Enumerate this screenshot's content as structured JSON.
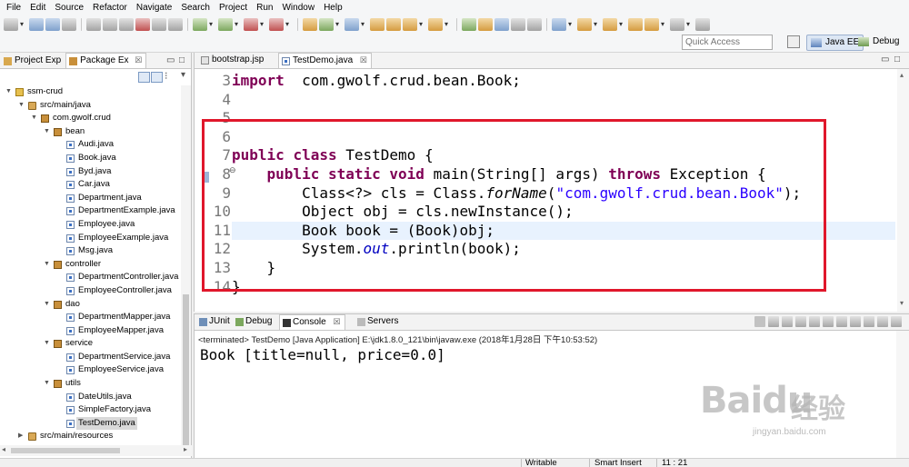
{
  "menu": [
    "File",
    "Edit",
    "Source",
    "Refactor",
    "Navigate",
    "Search",
    "Project",
    "Run",
    "Window",
    "Help"
  ],
  "quick_access": {
    "placeholder": "Quick Access"
  },
  "perspectives": {
    "java_ee": "Java EE",
    "debug": "Debug"
  },
  "left_panel": {
    "tabs": [
      {
        "label": "Project Exp"
      },
      {
        "label": "Package Ex"
      }
    ],
    "tree": [
      {
        "label": "ssm-crud",
        "depth": 0,
        "icon": "project-icon",
        "expanded": true
      },
      {
        "label": "src/main/java",
        "depth": 1,
        "icon": "source-folder-icon",
        "expanded": true
      },
      {
        "label": "com.gwolf.crud",
        "depth": 2,
        "icon": "package-icon",
        "expanded": true
      },
      {
        "label": "bean",
        "depth": 3,
        "icon": "package-icon",
        "expanded": true
      },
      {
        "label": "Audi.java",
        "depth": 4,
        "icon": "java-file-icon"
      },
      {
        "label": "Book.java",
        "depth": 4,
        "icon": "java-file-icon"
      },
      {
        "label": "Byd.java",
        "depth": 4,
        "icon": "java-file-icon"
      },
      {
        "label": "Car.java",
        "depth": 4,
        "icon": "java-file-icon"
      },
      {
        "label": "Department.java",
        "depth": 4,
        "icon": "java-file-icon"
      },
      {
        "label": "DepartmentExample.java",
        "depth": 4,
        "icon": "java-file-icon"
      },
      {
        "label": "Employee.java",
        "depth": 4,
        "icon": "java-file-icon"
      },
      {
        "label": "EmployeeExample.java",
        "depth": 4,
        "icon": "java-file-icon"
      },
      {
        "label": "Msg.java",
        "depth": 4,
        "icon": "java-file-icon"
      },
      {
        "label": "controller",
        "depth": 3,
        "icon": "package-icon",
        "expanded": true
      },
      {
        "label": "DepartmentController.java",
        "depth": 4,
        "icon": "java-file-icon"
      },
      {
        "label": "EmployeeController.java",
        "depth": 4,
        "icon": "java-file-icon"
      },
      {
        "label": "dao",
        "depth": 3,
        "icon": "package-icon",
        "expanded": true
      },
      {
        "label": "DepartmentMapper.java",
        "depth": 4,
        "icon": "java-file-icon"
      },
      {
        "label": "EmployeeMapper.java",
        "depth": 4,
        "icon": "java-file-icon"
      },
      {
        "label": "service",
        "depth": 3,
        "icon": "package-icon",
        "expanded": true
      },
      {
        "label": "DepartmentService.java",
        "depth": 4,
        "icon": "java-file-icon"
      },
      {
        "label": "EmployeeService.java",
        "depth": 4,
        "icon": "java-file-icon"
      },
      {
        "label": "utils",
        "depth": 3,
        "icon": "package-icon",
        "expanded": true
      },
      {
        "label": "DateUtils.java",
        "depth": 4,
        "icon": "java-file-icon"
      },
      {
        "label": "SimpleFactory.java",
        "depth": 4,
        "icon": "java-file-icon"
      },
      {
        "label": "TestDemo.java",
        "depth": 4,
        "icon": "java-file-icon",
        "selected": true
      },
      {
        "label": "src/main/resources",
        "depth": 1,
        "icon": "source-folder-icon",
        "expanded": false
      }
    ]
  },
  "editor": {
    "tabs": [
      {
        "label": "bootstrap.jsp"
      },
      {
        "label": "TestDemo.java",
        "active": true
      }
    ],
    "current_line": 11,
    "lines": [
      {
        "n": "3",
        "parts": [
          [
            "kw",
            "import"
          ],
          [
            "",
            "  com.gwolf.crud.bean.Book;"
          ]
        ]
      },
      {
        "n": "4",
        "parts": []
      },
      {
        "n": "5",
        "parts": []
      },
      {
        "n": "6",
        "parts": []
      },
      {
        "n": "7",
        "parts": [
          [
            "kw",
            "public"
          ],
          [
            "",
            " "
          ],
          [
            "kw",
            "class"
          ],
          [
            "",
            " TestDemo {"
          ]
        ]
      },
      {
        "n": "8",
        "parts": [
          [
            "",
            "    "
          ],
          [
            "kw",
            "public"
          ],
          [
            "",
            " "
          ],
          [
            "kw",
            "static"
          ],
          [
            "",
            " "
          ],
          [
            "kw",
            "void"
          ],
          [
            "",
            " main(String[] args) "
          ],
          [
            "kw",
            "throws"
          ],
          [
            "",
            " Exception {"
          ]
        ]
      },
      {
        "n": "9",
        "parts": [
          [
            "",
            "        Class<?> cls = Class."
          ],
          [
            "it",
            "forName"
          ],
          [
            "",
            "("
          ],
          [
            "str",
            "\"com.gwolf.crud.bean.Book\""
          ],
          [
            "",
            ");"
          ]
        ]
      },
      {
        "n": "10",
        "parts": [
          [
            "",
            "        Object obj = cls.newInstance();"
          ]
        ]
      },
      {
        "n": "11",
        "parts": [
          [
            "",
            "        Book book = (Book)obj;"
          ]
        ]
      },
      {
        "n": "12",
        "parts": [
          [
            "",
            "        System."
          ],
          [
            "fi",
            "out"
          ],
          [
            "",
            ".println(book);"
          ]
        ]
      },
      {
        "n": "13",
        "parts": [
          [
            "",
            "    }"
          ]
        ]
      },
      {
        "n": "14",
        "parts": [
          [
            "",
            "}"
          ]
        ]
      }
    ]
  },
  "console": {
    "tabs": [
      {
        "label": "JUnit"
      },
      {
        "label": "Debug"
      },
      {
        "label": "Console",
        "active": true
      },
      {
        "label": "Servers"
      }
    ],
    "terminated": "<terminated> TestDemo [Java Application] E:\\jdk1.8.0_121\\bin\\javaw.exe (2018年1月28日 下午10:53:52)",
    "output": "Book [title=null, price=0.0]"
  },
  "status_bar": {
    "mode": "Writable",
    "insert": "Smart Insert",
    "position": "11 : 21"
  },
  "watermark": {
    "brand": "Bai",
    "brand2": "du",
    "brand_cn": "经验",
    "url": "jingyan.baidu.com"
  },
  "colors": {
    "keyword": "#7f0055",
    "string": "#2a00ff",
    "highlight_box": "#e0172b",
    "current_line": "#e8f2fe"
  }
}
